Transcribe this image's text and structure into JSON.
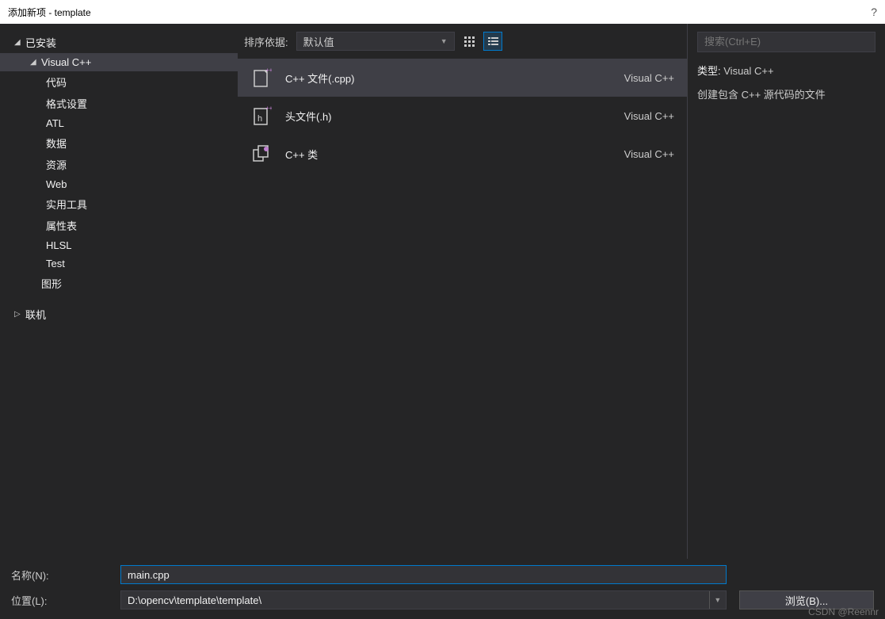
{
  "titlebar": {
    "title": "添加新项 - template",
    "help": "?"
  },
  "sidebar": {
    "installed": "已安装",
    "vcpp": "Visual C++",
    "items": [
      "代码",
      "格式设置",
      "ATL",
      "数据",
      "资源",
      "Web",
      "实用工具",
      "属性表",
      "HLSL",
      "Test"
    ],
    "graphics": "图形",
    "online": "联机"
  },
  "toolbar": {
    "sort_label": "排序依据:",
    "sort_value": "默认值"
  },
  "templates": [
    {
      "name": "C++ 文件(.cpp)",
      "lang": "Visual C++",
      "selected": true
    },
    {
      "name": "头文件(.h)",
      "lang": "Visual C++",
      "selected": false
    },
    {
      "name": "C++ 类",
      "lang": "Visual C++",
      "selected": false
    }
  ],
  "search": {
    "placeholder": "搜索(Ctrl+E)"
  },
  "details": {
    "type_label": "类型:",
    "type_value": "Visual C++",
    "description": "创建包含 C++ 源代码的文件"
  },
  "form": {
    "name_label": "名称(N):",
    "name_value": "main.cpp",
    "location_label": "位置(L):",
    "location_value": "D:\\opencv\\template\\template\\",
    "browse_label": "浏览(B)..."
  },
  "watermark": "CSDN @Reennr"
}
